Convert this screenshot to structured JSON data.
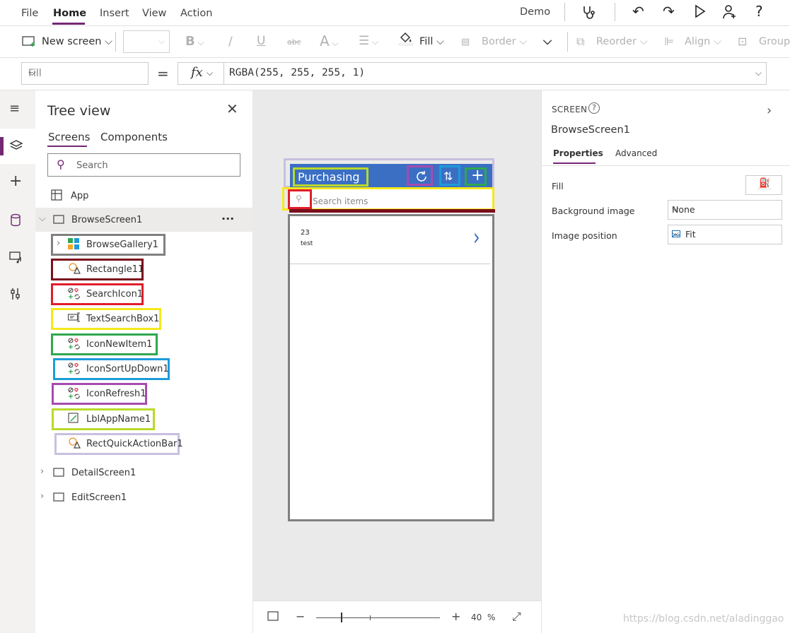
{
  "menu": {
    "items": [
      "File",
      "Home",
      "Insert",
      "View",
      "Action"
    ],
    "active": "Home",
    "app_name": "Demo"
  },
  "ribbon": {
    "new_screen": "New screen",
    "bold": "B",
    "italic": "/",
    "underline": "U",
    "strike": "abc",
    "font_size": "A",
    "fill": "Fill",
    "border": "Border",
    "reorder": "Reorder",
    "align": "Align",
    "group": "Group"
  },
  "formula_bar": {
    "property": "Fill",
    "equals": "=",
    "fx": "fx",
    "formula": "RGBA(255, 255, 255, 1)"
  },
  "tree": {
    "title": "Tree view",
    "tabs": [
      "Screens",
      "Components"
    ],
    "active_tab": "Screens",
    "search_placeholder": "Search",
    "app_label": "App",
    "selected_screen": "BrowseScreen1",
    "more": "···",
    "children": [
      {
        "name": "BrowseGallery1",
        "icon": "gallery-icon",
        "color": "#808080"
      },
      {
        "name": "Rectangle11",
        "icon": "shape-icon",
        "color": "#7a0f1b"
      },
      {
        "name": "SearchIcon1",
        "icon": "icon-control-icon",
        "color": "#e01d2a"
      },
      {
        "name": "TextSearchBox1",
        "icon": "text-input-icon",
        "color": "#f5e81a"
      },
      {
        "name": "IconNewItem1",
        "icon": "icon-control-icon",
        "color": "#2fa84f"
      },
      {
        "name": "IconSortUpDown1",
        "icon": "icon-control-icon",
        "color": "#1d9bd9"
      },
      {
        "name": "IconRefresh1",
        "icon": "icon-control-icon",
        "color": "#a64bb0"
      },
      {
        "name": "LblAppName1",
        "icon": "label-icon",
        "color": "#b9d92b"
      },
      {
        "name": "RectQuickActionBar1",
        "icon": "shape-icon",
        "color": "#c8bfe0"
      }
    ],
    "other_screens": [
      "DetailScreen1",
      "EditScreen1"
    ]
  },
  "canvas": {
    "app_title": "Purchasing",
    "search_placeholder": "Search items",
    "gallery_item_title": "23",
    "gallery_item_subtitle": "test",
    "header_color": "#3a6fc4"
  },
  "zoom": {
    "minus": "−",
    "plus": "+",
    "value": "40",
    "unit": "%"
  },
  "properties": {
    "caption": "SCREEN",
    "help": "?",
    "screen_name": "BrowseScreen1",
    "tabs": [
      "Properties",
      "Advanced"
    ],
    "active_tab": "Properties",
    "fill_label": "Fill",
    "background_image_label": "Background image",
    "background_image_value": "None",
    "image_position_label": "Image position",
    "image_position_value": "Fit"
  },
  "watermark": "https://blog.csdn.net/aladinggao",
  "accent_color": "#742774"
}
